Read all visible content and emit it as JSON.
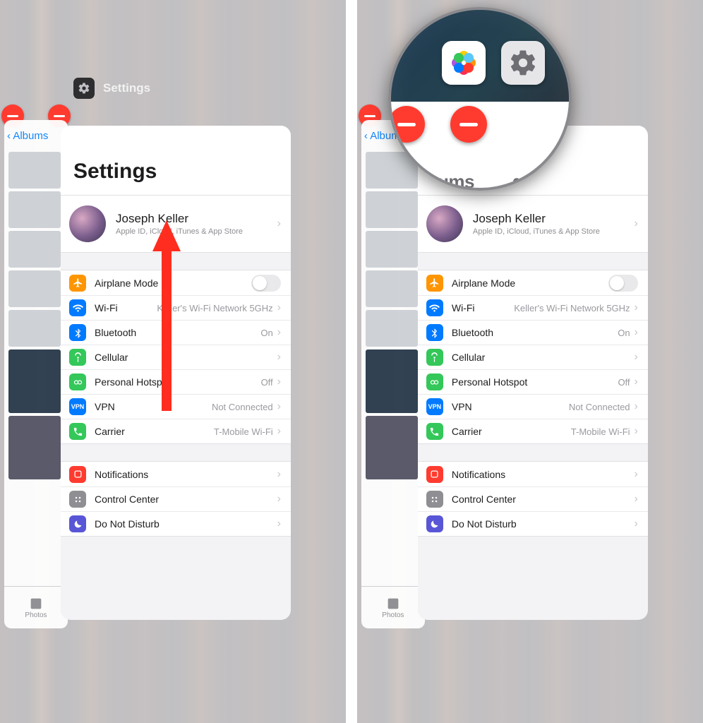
{
  "switcher": {
    "app_label": "Settings",
    "back_label": "Albums",
    "photos_tab": "Photos"
  },
  "settings": {
    "title": "Settings",
    "account": {
      "name": "Joseph Keller",
      "subtitle": "Apple ID, iCloud, iTunes & App Store"
    },
    "group1": [
      {
        "icon": "airplane",
        "label": "Airplane Mode",
        "detail": "",
        "toggle": true
      },
      {
        "icon": "wifi",
        "label": "Wi-Fi",
        "detail": "Keller's Wi-Fi Network 5GHz"
      },
      {
        "icon": "bt",
        "label": "Bluetooth",
        "detail": "On"
      },
      {
        "icon": "cell",
        "label": "Cellular",
        "detail": ""
      },
      {
        "icon": "hotspot",
        "label": "Personal Hotspot",
        "detail": "Off"
      },
      {
        "icon": "vpn",
        "label": "VPN",
        "detail": "Not Connected"
      },
      {
        "icon": "carrier",
        "label": "Carrier",
        "detail": "T-Mobile Wi-Fi"
      }
    ],
    "group2": [
      {
        "icon": "notif",
        "label": "Notifications",
        "detail": ""
      },
      {
        "icon": "cc",
        "label": "Control Center",
        "detail": ""
      },
      {
        "icon": "dnd",
        "label": "Do Not Disturb",
        "detail": ""
      }
    ]
  },
  "magnifier": {
    "partial_text_left": "bums",
    "partial_text_right": "gs"
  }
}
